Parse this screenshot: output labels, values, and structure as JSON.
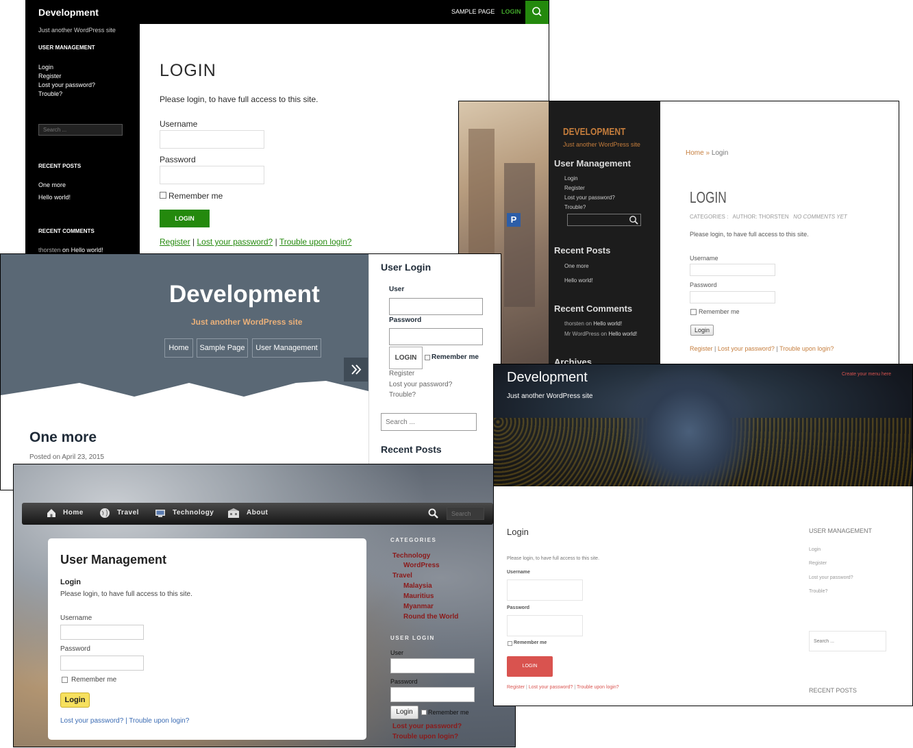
{
  "s1": {
    "site_title": "Development",
    "tagline": "Just another WordPress site",
    "nav": [
      "SAMPLE PAGE",
      "LOGIN"
    ],
    "search_icon": "magnifier-icon",
    "colors": {
      "accent": "#24890d",
      "nav_active": "#41a62a"
    },
    "sidebar": {
      "um_heading": "USER MANAGEMENT",
      "um_links": [
        "Login",
        "Register",
        "Lost your password?",
        "Trouble?"
      ],
      "search_placeholder": "Search ...",
      "recent_posts_heading": "RECENT POSTS",
      "recent_posts": [
        "One more",
        "Hello world!"
      ],
      "recent_comments_heading": "RECENT COMMENTS",
      "comment_author": "thorsten",
      "comment_on": "on",
      "comment_post": "Hello world!"
    },
    "main": {
      "title": "LOGIN",
      "intro": "Please login, to have full access to this site.",
      "username_label": "Username",
      "password_label": "Password",
      "remember": "Remember me",
      "login_button": "LOGIN",
      "links": [
        "Register",
        "Lost your password?",
        "Trouble upon login?"
      ],
      "sep": "|"
    }
  },
  "s2": {
    "site_title": "DEVELOPMENT",
    "tagline": "Just another WordPress site",
    "colors": {
      "accent": "#c57d3c"
    },
    "um_heading": "User Management",
    "um_links": [
      "Login",
      "Register",
      "Lost your password?",
      "Trouble?"
    ],
    "recent_posts_heading": "Recent Posts",
    "recent_posts": [
      "One more",
      "Hello world!"
    ],
    "recent_comments_heading": "Recent Comments",
    "comments": [
      {
        "author": "thorsten",
        "on": "on",
        "post": "Hello world!"
      },
      {
        "author": "Mr WordPress",
        "on": "on",
        "post": "Hello world!"
      }
    ],
    "archives_heading": "Archives",
    "breadcrumb_home": "Home",
    "breadcrumb_sep": "»",
    "breadcrumb_current": "Login",
    "title": "LOGIN",
    "meta_categories": "CATEGORIES :",
    "meta_author": "AUTHOR: THORSTEN",
    "meta_comments": "NO COMMENTS YET",
    "intro": "Please login, to have full access to this site.",
    "username_label": "Username",
    "password_label": "Password",
    "remember": "Remember me",
    "login_button": "Login",
    "links": [
      "Register",
      "Lost your password?",
      "Trouble upon login?"
    ],
    "sep": "|"
  },
  "s3": {
    "site_title": "Development",
    "tagline": "Just another WordPress site",
    "colors": {
      "header": "#5a6875",
      "tagline": "#e9b07a"
    },
    "nav": [
      "Home",
      "Sample Page",
      "User Management"
    ],
    "toggle_icon": "double-chevron-right-icon",
    "post_title": "One more",
    "posted_on": "Posted on April 23, 2015",
    "widget_title": "User Login",
    "user_label": "User",
    "password_label": "Password",
    "login_button": "LOGIN",
    "remember": "Remember me",
    "links": [
      "Register",
      "Lost your password?",
      "Trouble?"
    ],
    "search_placeholder": "Search ...",
    "recent_posts_heading": "Recent Posts"
  },
  "s4": {
    "nav": [
      {
        "label": "Home",
        "icon": "house-icon"
      },
      {
        "label": "Travel",
        "icon": "globe-icon"
      },
      {
        "label": "Technology",
        "icon": "monitor-icon"
      },
      {
        "label": "About",
        "icon": "building-icon"
      }
    ],
    "search_placeholder": "Search",
    "colors": {
      "link": "#8b1a1a",
      "button": "#f6e05e"
    },
    "card_title": "User Management",
    "subtitle": "Login",
    "intro": "Please login, to have full access to this site.",
    "username_label": "Username",
    "password_label": "Password",
    "remember": "Remember me",
    "login_button": "Login",
    "link_lost": "Lost your password?",
    "link_sep": "|",
    "link_trouble": "Trouble upon login?",
    "categories_heading": "CATEGORIES",
    "categories": [
      "Technology",
      "WordPress",
      "Travel",
      "Malaysia",
      "Mauritius",
      "Myanmar",
      "Round the World"
    ],
    "user_login_heading": "USER LOGIN",
    "user_label": "User",
    "side_password_label": "Password",
    "side_login_button": "Login",
    "side_remember": "Remember me",
    "side_links": [
      "Lost your password?",
      "Trouble upon login?"
    ]
  },
  "s5": {
    "site_title": "Development",
    "tagline": "Just another WordPress site",
    "menu_link": "Create your menu here",
    "colors": {
      "accent": "#d9534f"
    },
    "title": "Login",
    "intro": "Please login, to have full access to this site.",
    "username_label": "Username",
    "password_label": "Password",
    "remember": "Remember me",
    "login_button": "LOGIN",
    "links": [
      "Register",
      "Lost your password?",
      "Trouble upon login?"
    ],
    "sep": "|",
    "um_heading": "USER MANAGEMENT",
    "um_links": [
      "Login",
      "Register",
      "Lost your password?",
      "Trouble?"
    ],
    "search_placeholder": "Search ...",
    "recent_posts_heading": "RECENT POSTS"
  }
}
